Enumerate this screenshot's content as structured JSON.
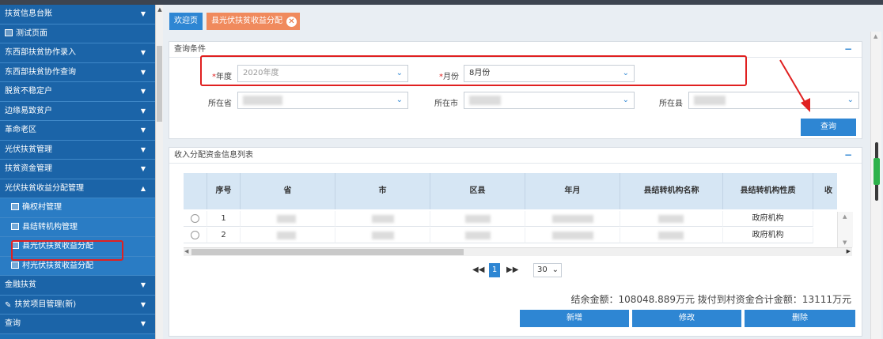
{
  "sidebar": {
    "items": [
      {
        "label": "扶贫信息台账",
        "type": "group"
      },
      {
        "label": "测试页面",
        "type": "plain"
      },
      {
        "label": "东西部扶贫协作录入",
        "type": "group"
      },
      {
        "label": "东西部扶贫协作查询",
        "type": "group"
      },
      {
        "label": "脱贫不稳定户",
        "type": "group"
      },
      {
        "label": "边缘易致贫户",
        "type": "group"
      },
      {
        "label": "革命老区",
        "type": "group"
      },
      {
        "label": "光伏扶贫管理",
        "type": "group"
      },
      {
        "label": "扶贫资金管理",
        "type": "group"
      },
      {
        "label": "光伏扶贫收益分配管理",
        "type": "group-open"
      },
      {
        "label": "确权村管理",
        "type": "sub"
      },
      {
        "label": "县结转机构管理",
        "type": "sub"
      },
      {
        "label": "县光伏扶贫收益分配",
        "type": "sub-active"
      },
      {
        "label": "村光伏扶贫收益分配",
        "type": "sub"
      },
      {
        "label": "金融扶贫",
        "type": "group"
      },
      {
        "label": "扶贫项目管理(新)",
        "type": "group"
      },
      {
        "label": "查询",
        "type": "group"
      }
    ]
  },
  "tabs": {
    "home": "欢迎页",
    "active": "县光伏扶贫收益分配",
    "close_glyph": "✕"
  },
  "query": {
    "title": "查询条件",
    "year_label": "年度",
    "year_value": "2020年度",
    "month_label": "月份",
    "month_value": "8月份",
    "province_label": "所在省",
    "city_label": "所在市",
    "county_label": "所在县",
    "search_button": "查询",
    "required_mark": "*"
  },
  "table_section": {
    "title": "收入分配资金信息列表",
    "columns": [
      "序号",
      "省",
      "市",
      "区县",
      "年月",
      "县结转机构名称",
      "县结转机构性质",
      "收"
    ],
    "rows": [
      {
        "index": "1",
        "nature": "政府机构"
      },
      {
        "index": "2",
        "nature": "政府机构"
      }
    ]
  },
  "pager": {
    "current_page": "1",
    "page_size": "30"
  },
  "summary": {
    "text": "结余金额：108048.889万元   拨付到村资金合计金额：13111万元"
  },
  "actions": {
    "add": "新增",
    "edit": "修改",
    "delete": "删除"
  },
  "colors": {
    "sidebar": "#1e6fb5",
    "accent": "#2e86d3",
    "active_tab": "#f08a5d",
    "highlight": "#e02020"
  }
}
